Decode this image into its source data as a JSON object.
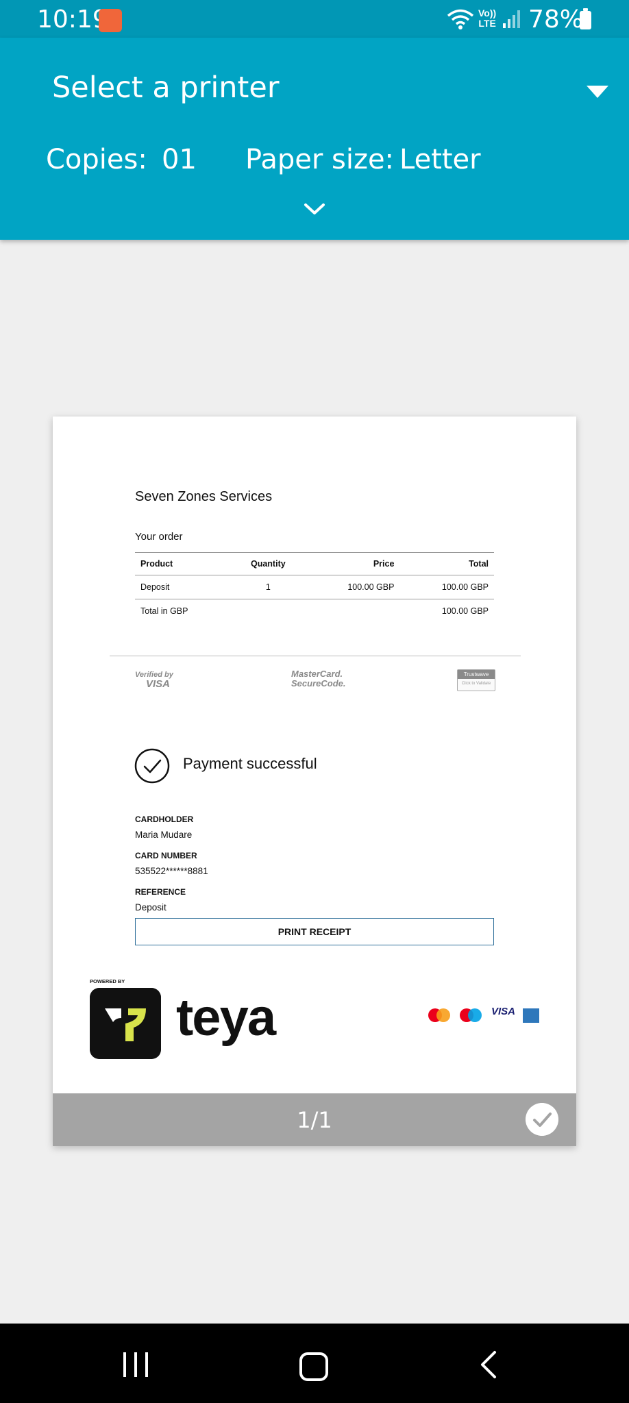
{
  "status_bar": {
    "time": "10:19",
    "network": "Vo))\nLTE",
    "battery": "78%",
    "icons": [
      "app-notification-icon",
      "wifi-icon",
      "volte-icon",
      "signal-icon",
      "battery-icon"
    ]
  },
  "print_options": {
    "printer_select": "Select a printer",
    "copies_label": "Copies:",
    "copies_value": "01",
    "paper_size_label": "Paper size:",
    "paper_size_value": "Letter"
  },
  "receipt": {
    "merchant": "Seven Zones Services",
    "order_title": "Your order",
    "table": {
      "headers": [
        "Product",
        "Quantity",
        "Price",
        "Total"
      ],
      "rows": [
        [
          "Deposit",
          "1",
          "100.00 GBP",
          "100.00 GBP"
        ]
      ],
      "total_label": "Total in GBP",
      "total_value": "100.00 GBP"
    },
    "secure_logos": {
      "verified_by": "Verified by",
      "visa": "VISA",
      "mastercard": "MasterCard.",
      "securecode": "SecureCode.",
      "trustwave": "Trustwave",
      "trustwave_sub": "Click to Validate"
    },
    "payment_status": "Payment successful",
    "details": {
      "cardholder_label": "CARDHOLDER",
      "cardholder_value": "Maria Mudare",
      "card_number_label": "CARD NUMBER",
      "card_number_value": "535522******8881",
      "reference_label": "REFERENCE",
      "reference_value": "Deposit"
    },
    "print_button": "PRINT RECEIPT",
    "powered_by": "POWERED BY",
    "brand": "teya",
    "card_brands": {
      "visa": "VISA"
    }
  },
  "page_indicator": "1/1",
  "colors": {
    "status_bar": "#0197b5",
    "header": "#01a4c4",
    "page_footer": "#a4a4a4",
    "teya_accent": "#d8e34b"
  }
}
